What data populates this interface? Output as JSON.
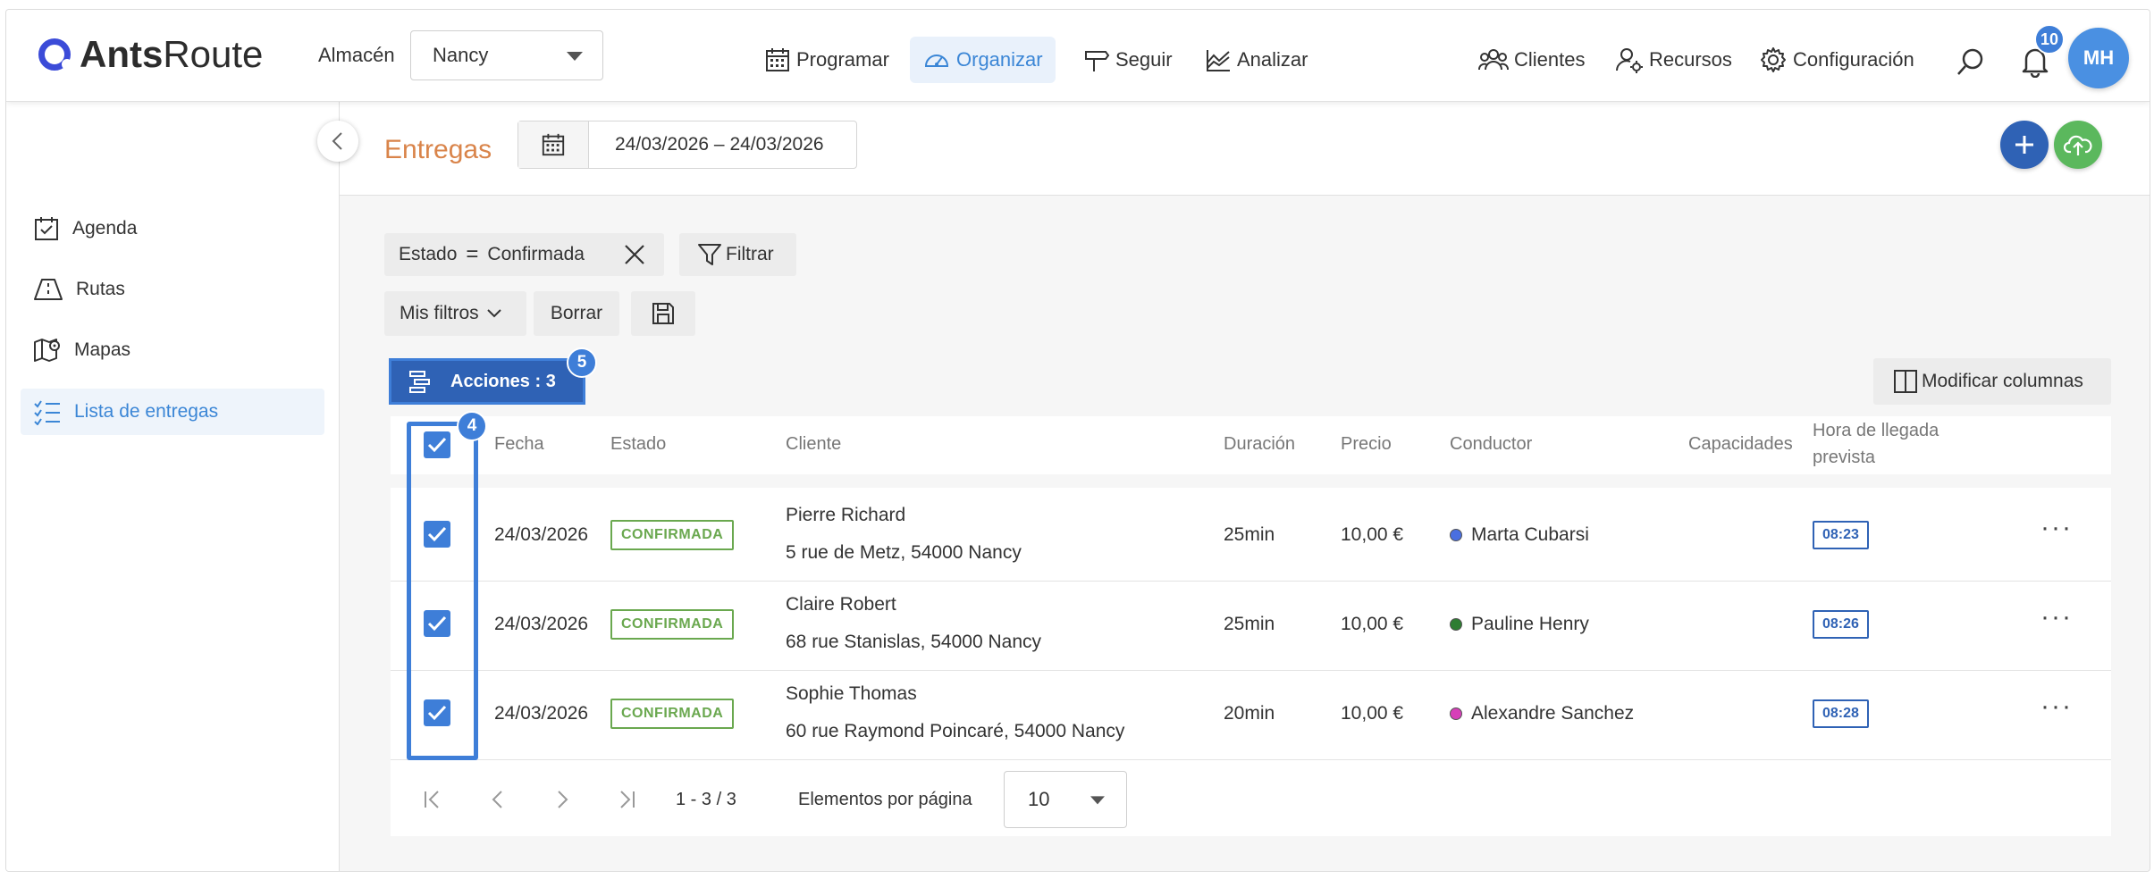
{
  "app": {
    "logo_bold": "Ants",
    "logo_thin": "Route"
  },
  "topbar": {
    "almacen_label": "Almacén",
    "almacen_value": "Nancy",
    "nav": [
      {
        "label": "Programar",
        "icon": "calendar-icon"
      },
      {
        "label": "Organizar",
        "icon": "dashboard-icon",
        "active": true
      },
      {
        "label": "Seguir",
        "icon": "signpost-icon"
      },
      {
        "label": "Analizar",
        "icon": "chart-icon"
      }
    ],
    "right_nav": [
      {
        "label": "Clientes",
        "icon": "users-icon"
      },
      {
        "label": "Recursos",
        "icon": "user-gear-icon"
      },
      {
        "label": "Configuración",
        "icon": "gear-icon"
      }
    ],
    "notification_count": "10",
    "avatar_initials": "MH"
  },
  "sidebar": {
    "items": [
      {
        "label": "Agenda",
        "icon": "calendar-check-icon"
      },
      {
        "label": "Rutas",
        "icon": "route-icon"
      },
      {
        "label": "Mapas",
        "icon": "map-icon"
      },
      {
        "label": "Lista de entregas",
        "icon": "list-icon",
        "active": true
      }
    ]
  },
  "page": {
    "title": "Entregas",
    "date_range": "24/03/2026 – 24/03/2026"
  },
  "filters": {
    "active_filter_field": "Estado",
    "active_filter_op": "=",
    "active_filter_value": "Confirmada",
    "filter_button": "Filtrar",
    "my_filters": "Mis filtros",
    "clear": "Borrar"
  },
  "actions": {
    "label": "Acciones : 3",
    "badge": "5",
    "checkbox_badge": "4",
    "modify_columns": "Modificar columnas"
  },
  "table": {
    "headers": {
      "fecha": "Fecha",
      "estado": "Estado",
      "cliente": "Cliente",
      "duracion": "Duración",
      "precio": "Precio",
      "conductor": "Conductor",
      "capacidades": "Capacidades",
      "hora_line1": "Hora de llegada",
      "hora_line2": "prevista"
    },
    "rows": [
      {
        "fecha": "24/03/2026",
        "estado": "CONFIRMADA",
        "cliente": "Pierre Richard",
        "direccion": "5 rue de Metz, 54000 Nancy",
        "duracion": "25min",
        "precio": "10,00 €",
        "conductor": "Marta Cubarsi",
        "color": "#4a6fe0",
        "hora": "08:23"
      },
      {
        "fecha": "24/03/2026",
        "estado": "CONFIRMADA",
        "cliente": "Claire Robert",
        "direccion": "68 rue Stanislas, 54000 Nancy",
        "duracion": "25min",
        "precio": "10,00 €",
        "conductor": "Pauline Henry",
        "color": "#2e7d32",
        "hora": "08:26"
      },
      {
        "fecha": "24/03/2026",
        "estado": "CONFIRMADA",
        "cliente": "Sophie Thomas",
        "direccion": "60 rue Raymond Poincaré, 54000 Nancy",
        "duracion": "20min",
        "precio": "10,00 €",
        "conductor": "Alexandre Sanchez",
        "color": "#d63fb8",
        "hora": "08:28"
      }
    ]
  },
  "pagination": {
    "range": "1 - 3 / 3",
    "per_page_label": "Elementos por página",
    "per_page_value": "10"
  }
}
